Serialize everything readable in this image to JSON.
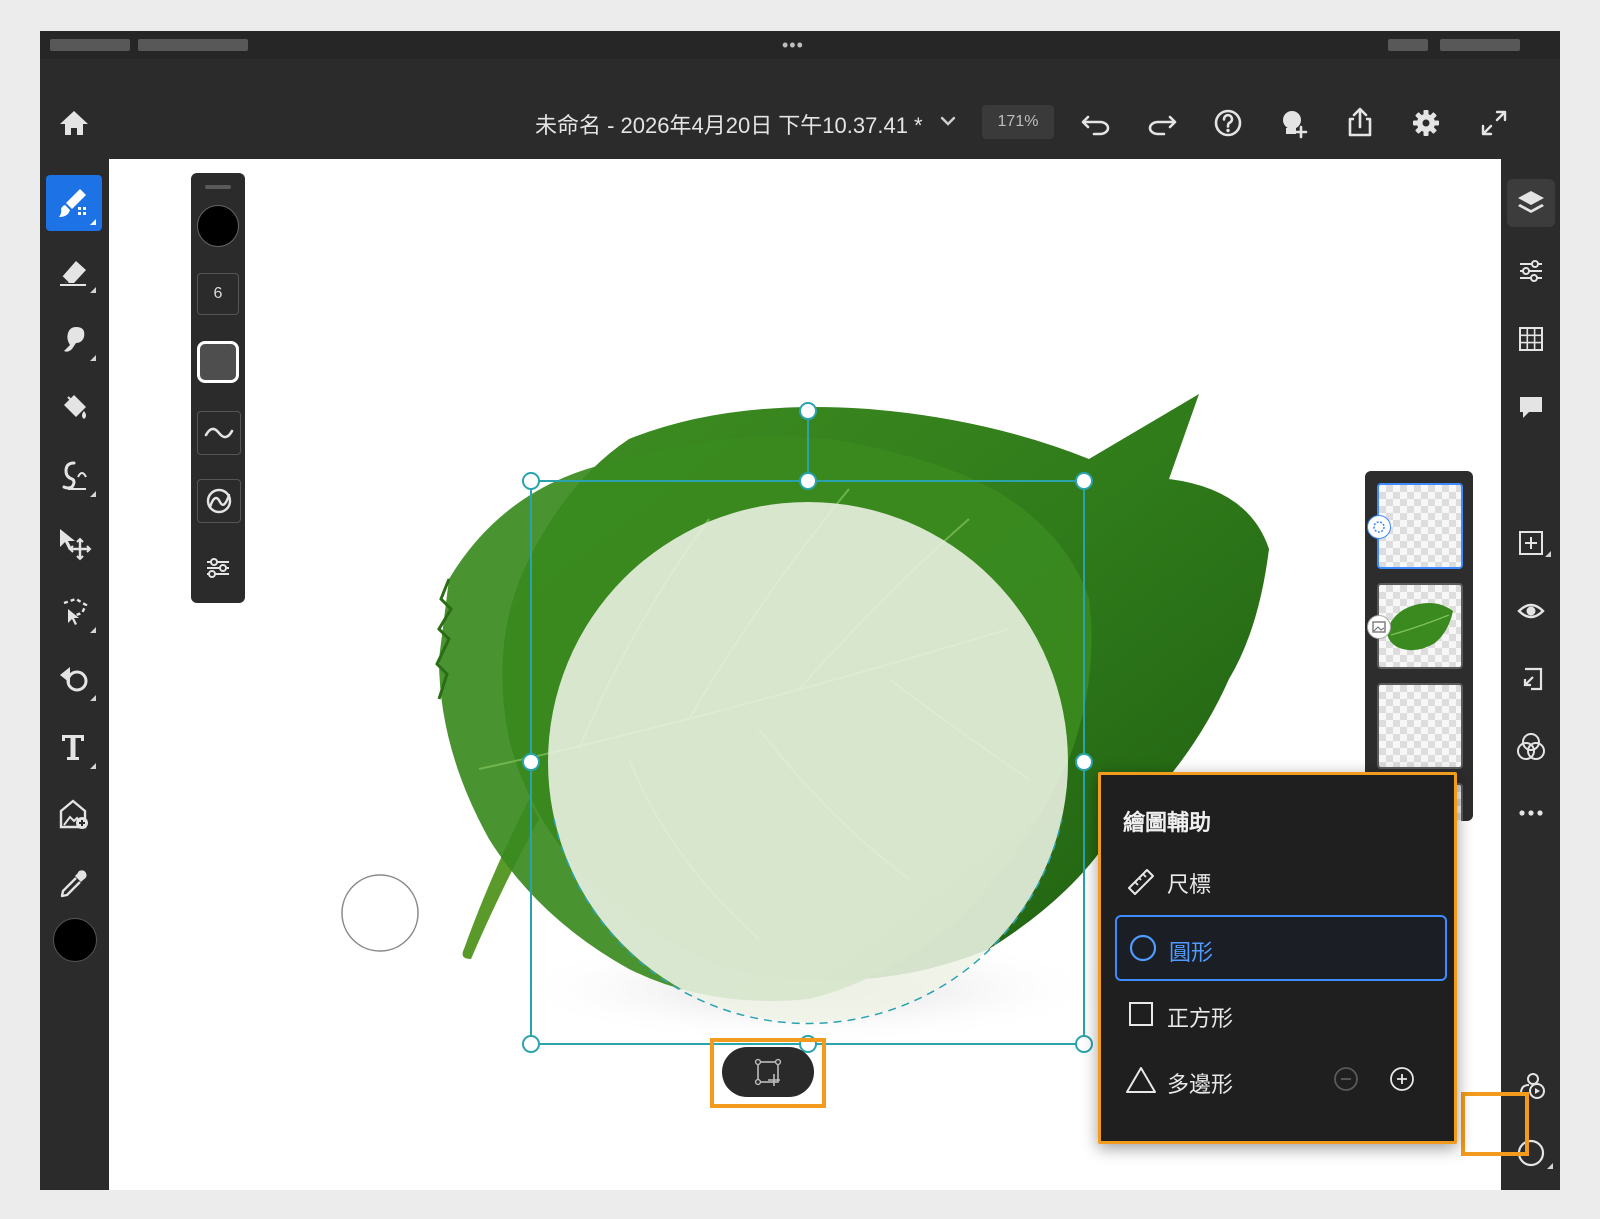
{
  "document": {
    "title": "未命名 - 2026年4月20日 下午10.37.41 *",
    "zoom": "171%"
  },
  "topbar": {
    "icons": [
      "home-icon",
      "chevron-down-icon",
      "undo-icon",
      "redo-icon",
      "help-icon",
      "user-add-icon",
      "share-icon",
      "gear-icon",
      "fullscreen-icon"
    ]
  },
  "brush_panel": {
    "size": "6"
  },
  "left_tools": [
    "brush-icon",
    "eraser-icon",
    "smudge-icon",
    "fill-icon",
    "liquify-icon",
    "move-icon",
    "lasso-icon",
    "clone-stamp-icon",
    "type-icon",
    "place-image-icon",
    "eyedropper-icon"
  ],
  "right_tools": [
    "layers-icon",
    "adjustments-icon",
    "grid-icon",
    "comment-icon",
    "add-layer-icon",
    "visibility-icon",
    "import-icon",
    "blend-icon",
    "more-icon",
    "live-stream-icon",
    "drawing-aid-icon"
  ],
  "drawing_aids": {
    "title": "繪圖輔助",
    "items": [
      {
        "label": "尺標",
        "icon": "ruler-icon"
      },
      {
        "label": "圓形",
        "icon": "circle-icon"
      },
      {
        "label": "正方形",
        "icon": "square-icon"
      },
      {
        "label": "多邊形",
        "icon": "triangle-icon"
      }
    ],
    "selected": "圓形"
  },
  "colors": {
    "accent": "#1d72e6",
    "highlight": "#f29b1d",
    "guide": "#2aa3ad",
    "selected_text": "#4f9bff"
  }
}
